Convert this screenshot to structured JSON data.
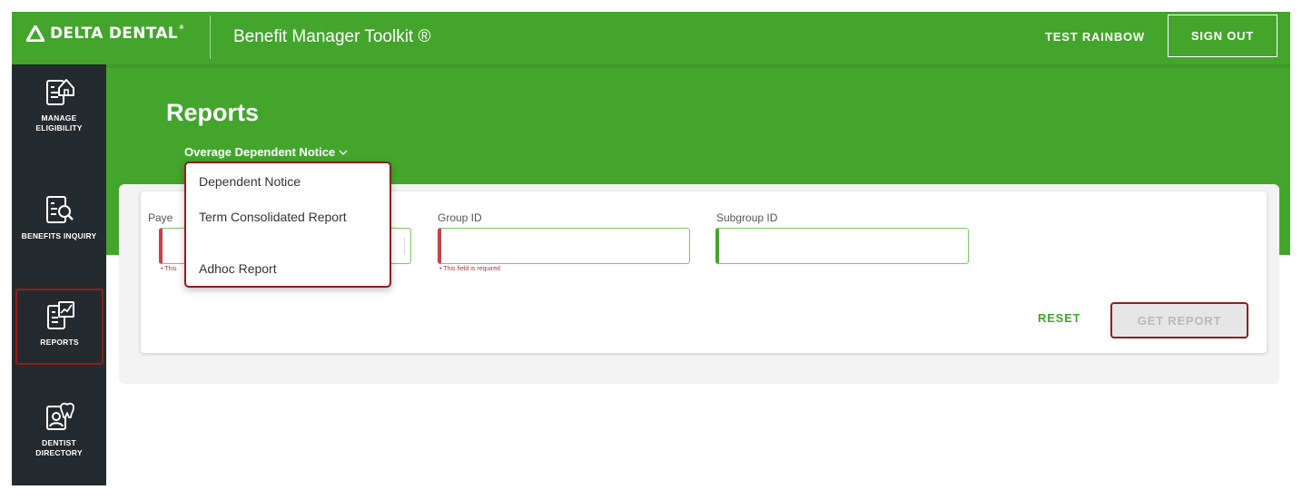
{
  "header": {
    "brand": "DELTA DENTAL",
    "app_title": "Benefit Manager Toolkit ®",
    "username": "TEST RAINBOW",
    "sign_out_label": "SIGN OUT"
  },
  "sidebar": {
    "items": [
      {
        "label": "MANAGE ELIGIBILITY",
        "icon": "house-document-icon"
      },
      {
        "label": "BENEFITS INQUIRY",
        "icon": "document-search-icon"
      },
      {
        "label": "REPORTS",
        "icon": "document-chart-icon",
        "active": true
      },
      {
        "label": "DENTIST DIRECTORY",
        "icon": "dentist-tooth-icon"
      }
    ]
  },
  "page": {
    "title": "Reports",
    "report_type_selected": "Overage Dependent Notice"
  },
  "form": {
    "payer_label_partial": "Paye",
    "payer_hint_partial": "• This",
    "group_id_label": "Group ID",
    "group_id_hint": "• This field is required",
    "subgroup_id_label": "Subgroup ID",
    "group_id_value": "",
    "subgroup_id_value": ""
  },
  "actions": {
    "reset_label": "RESET",
    "get_report_label": "GET REPORT"
  },
  "dropdown": {
    "options": [
      "Dependent Notice",
      "Term Consolidated Report",
      "Adhoc Report"
    ]
  },
  "colors": {
    "brand_green": "#43a52c",
    "sidebar_dark": "#252a2e",
    "highlight_red": "#8e1f1f",
    "error_red": "#c2424b"
  }
}
